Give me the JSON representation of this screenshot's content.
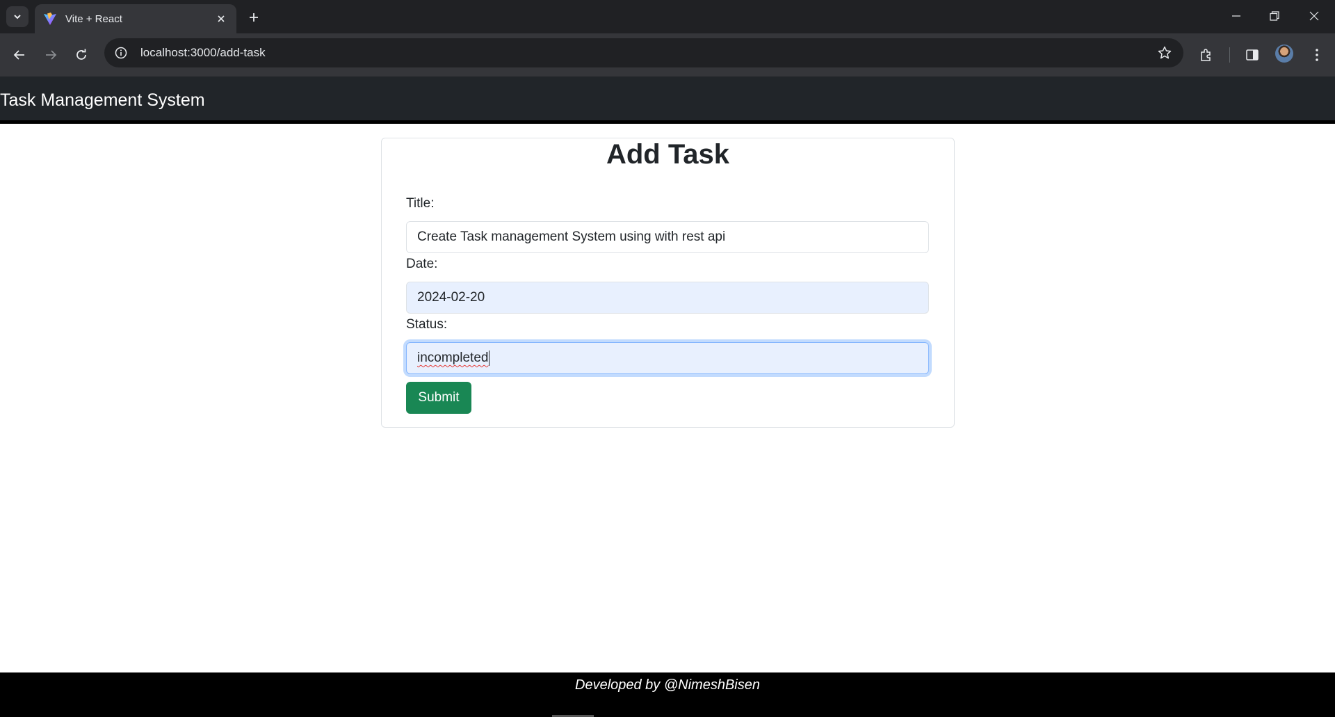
{
  "browser": {
    "tab_title": "Vite + React",
    "url": "localhost:3000/add-task"
  },
  "app": {
    "header_title": "Task Management System"
  },
  "form": {
    "heading": "Add Task",
    "title_label": "Title:",
    "title_value": "Create Task management System using with rest api",
    "date_label": "Date:",
    "date_value": "2024-02-20",
    "status_label": "Status:",
    "status_value": "incompleted",
    "submit_label": "Submit"
  },
  "footer": {
    "text": "Developed by @NimeshBisen"
  },
  "colors": {
    "header_bg": "#212529",
    "submit_bg": "#198754",
    "autofill_bg": "#e8f0fe",
    "focus_border": "#86b7fe"
  }
}
